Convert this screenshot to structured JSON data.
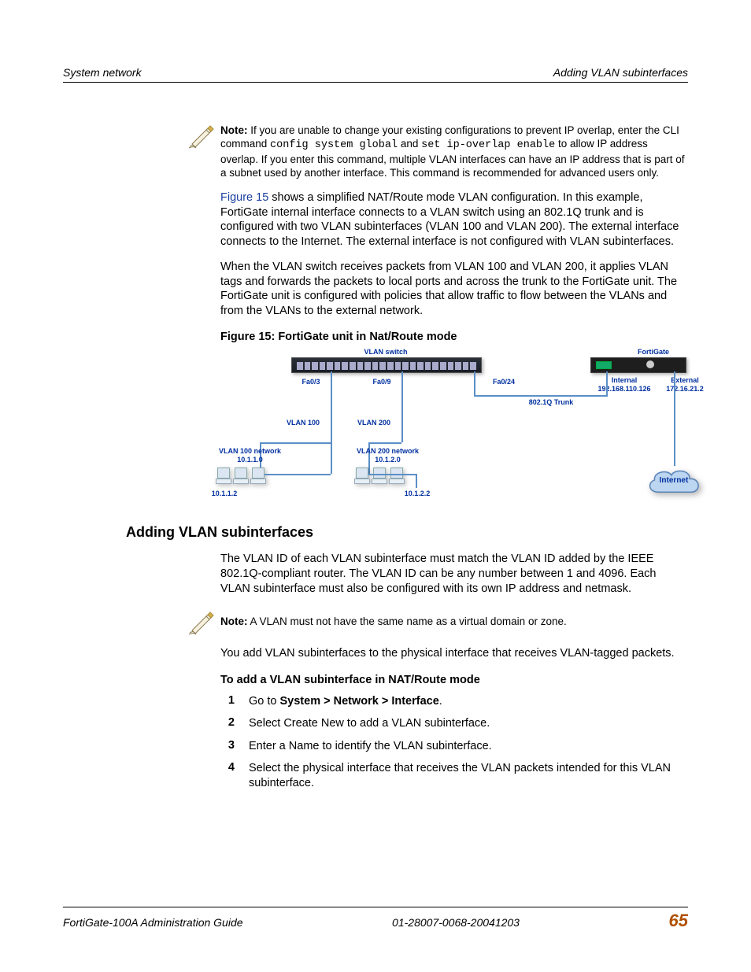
{
  "header": {
    "left": "System network",
    "right": "Adding VLAN subinterfaces"
  },
  "note1": {
    "label": "Note:",
    "before_code1": " If you are unable to change your existing configurations to prevent IP overlap, enter the CLI command ",
    "code1": "config system global",
    "between": " and ",
    "code2": "set ip-overlap enable",
    "after_code2": " to allow IP address overlap. If you enter this command, multiple VLAN interfaces can have an IP address that is part of a subnet used by another interface. This command is recommended for advanced users only."
  },
  "para1": {
    "link": "Figure 15",
    "rest": " shows a simplified NAT/Route mode VLAN configuration. In this example, FortiGate internal interface connects to a VLAN switch using an 802.1Q trunk and is configured with two VLAN subinterfaces (VLAN 100 and VLAN 200). The external interface connects to the Internet. The external interface is not configured with VLAN subinterfaces."
  },
  "para2": "When the VLAN switch receives packets from VLAN 100 and VLAN 200, it applies VLAN tags and forwards the packets to local ports and across the trunk to the FortiGate unit. The FortiGate unit is configured with policies that allow traffic to flow between the VLANs and from the VLANs to the external network.",
  "figure": {
    "caption": "Figure 15: FortiGate unit in Nat/Route mode",
    "vlan_switch": "VLAN switch",
    "fortigate": "FortiGate",
    "fa03": "Fa0/3",
    "fa09": "Fa0/9",
    "fa024": "Fa0/24",
    "internal_label": "Internal",
    "internal_ip": "192.168.110.126",
    "external_label": "External",
    "external_ip": "172.16.21.2",
    "trunk": "802.1Q Trunk",
    "vlan100": "VLAN 100",
    "vlan200": "VLAN 200",
    "vlan100_net_l1": "VLAN 100 network",
    "vlan100_net_l2": "10.1.1.0",
    "vlan200_net_l1": "VLAN 200 network",
    "vlan200_net_l2": "10.1.2.0",
    "host1": "10.1.1.2",
    "host2": "10.1.2.2",
    "internet": "Internet"
  },
  "section": {
    "title": "Adding VLAN subinterfaces",
    "intro": "The VLAN ID of each VLAN subinterface must match the VLAN ID added by the IEEE 802.1Q-compliant router. The VLAN ID can be any number between 1 and 4096. Each VLAN subinterface must also be configured with its own IP address and netmask."
  },
  "note2": {
    "label": "Note:",
    "text": " A VLAN must not have the same name as a virtual domain or zone."
  },
  "para3": "You add VLAN subinterfaces to the physical interface that receives VLAN-tagged packets.",
  "procedure": {
    "title": "To add a VLAN subinterface in NAT/Route mode",
    "steps": [
      {
        "n": "1",
        "pre": "Go to ",
        "bold": "System > Network > Interface",
        "post": "."
      },
      {
        "n": "2",
        "pre": "Select Create New to add a VLAN subinterface.",
        "bold": "",
        "post": ""
      },
      {
        "n": "3",
        "pre": "Enter a Name to identify the VLAN subinterface.",
        "bold": "",
        "post": ""
      },
      {
        "n": "4",
        "pre": "Select the physical interface that receives the VLAN packets intended for this VLAN subinterface.",
        "bold": "",
        "post": ""
      }
    ]
  },
  "footer": {
    "left": "FortiGate-100A Administration Guide",
    "mid": "01-28007-0068-20041203",
    "page": "65"
  }
}
